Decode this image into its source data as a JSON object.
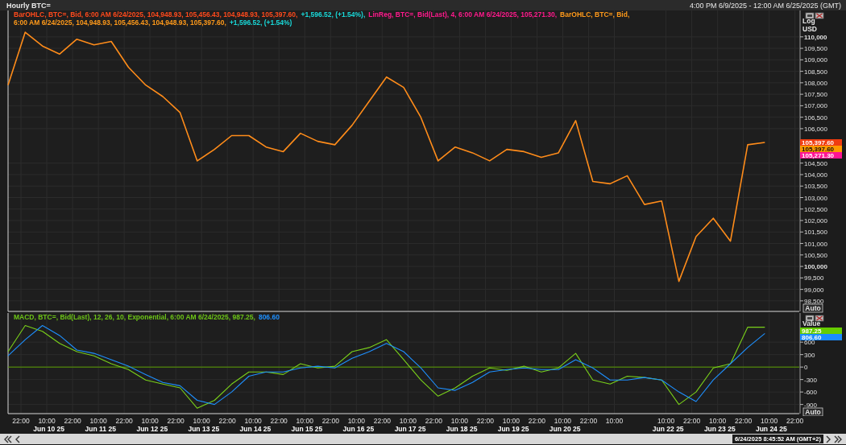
{
  "window": {
    "title": "Hourly BTC=",
    "range": "4:00 PM 6/9/2025 - 12:00 AM 6/25/2025 (GMT)"
  },
  "price_pane": {
    "legend": [
      [
        {
          "text": "BarOHLC, BTC=, Bid,  6:00 AM 6/24/2025, 104,948.93, 105,456.43, 104,948.93, 105,397.60,",
          "color": "#ff4a1c"
        },
        {
          "text": "+1,596.52, (+1.54%),",
          "color": "#19d8d8"
        },
        {
          "text": "LinReg, BTC=, Bid(Last),  4, 6:00 AM 6/24/2025, 105,271.30,",
          "color": "#ff1a8c"
        },
        {
          "text": "BarOHLC, BTC=, Bid,",
          "color": "#ff9a1a"
        }
      ],
      [
        {
          "text": "6:00 AM 6/24/2025, 104,948.93, 105,456.43, 104,948.93, 105,397.60,",
          "color": "#ff9a1a"
        },
        {
          "text": "+1,596.52, (+1.54%)",
          "color": "#19d8d8"
        }
      ]
    ],
    "axis": {
      "scale": "Log",
      "currency": "USD",
      "auto": "Auto",
      "badges": [
        {
          "text": "105,397.60",
          "color": "#f03c10"
        },
        {
          "text": "105,397.60",
          "color": "#ff9900"
        },
        {
          "text": "105,271.30",
          "color": "#ff1493"
        }
      ]
    },
    "chart_data": {
      "type": "line",
      "grid": true,
      "ylim": [
        98040,
        111150
      ],
      "yticks": [
        {
          "value": 110000,
          "label": "110,000"
        },
        {
          "value": 109500,
          "label": "109,500"
        },
        {
          "value": 109000,
          "label": "109,000"
        },
        {
          "value": 108500,
          "label": "108,500"
        },
        {
          "value": 108000,
          "label": "108,000"
        },
        {
          "value": 107500,
          "label": "107,500"
        },
        {
          "value": 107000,
          "label": "107,000"
        },
        {
          "value": 106500,
          "label": "106,500"
        },
        {
          "value": 106000,
          "label": "106,000"
        },
        {
          "value": 104500,
          "label": "104,500"
        },
        {
          "value": 104000,
          "label": "104,000"
        },
        {
          "value": 103500,
          "label": "103,500"
        },
        {
          "value": 103000,
          "label": "103,000"
        },
        {
          "value": 102500,
          "label": "102,500"
        },
        {
          "value": 102000,
          "label": "102,000"
        },
        {
          "value": 101500,
          "label": "101,500"
        },
        {
          "value": 101000,
          "label": "101,000"
        },
        {
          "value": 100500,
          "label": "100,500"
        },
        {
          "value": 100000,
          "label": "100,000"
        },
        {
          "value": 99500,
          "label": "99,500"
        },
        {
          "value": 99000,
          "label": "99,000"
        },
        {
          "value": 98500,
          "label": "98,500"
        }
      ],
      "series": [
        {
          "color": "#ff8c1a",
          "values": [
            107900,
            110200,
            109600,
            109250,
            109900,
            109650,
            109800,
            108680,
            107900,
            107400,
            106700,
            104600,
            105100,
            105700,
            105700,
            105200,
            105000,
            105800,
            105450,
            105300,
            106150,
            107200,
            108250,
            107800,
            106500,
            104600,
            105200,
            104950,
            104600,
            105100,
            105000,
            104750,
            104950,
            106350,
            103700,
            103600,
            103950,
            102700,
            102850,
            99350,
            101300,
            102100,
            101100,
            105300,
            105400
          ]
        }
      ]
    }
  },
  "macd_pane": {
    "legend": [
      {
        "text": "MACD, BTC=, Bid(Last),  12, 26, 10, Exponential, 6:00 AM 6/24/2025, 987.25,",
        "color": "#6cc417"
      },
      {
        "text": "806.60",
        "color": "#1e90ff"
      }
    ],
    "axis": {
      "title": "Value",
      "auto": "Auto",
      "badges": [
        {
          "text": "987.25",
          "color": "#66cc00"
        },
        {
          "text": "806.60",
          "color": "#1a8cff"
        }
      ]
    },
    "chart_data": {
      "type": "line",
      "grid": true,
      "ref_lines": [
        {
          "axis": "y",
          "value": 0,
          "color": "#5aa000"
        }
      ],
      "ylim": [
        -1120,
        1300
      ],
      "yticks": [
        {
          "value": 600,
          "label": "600"
        },
        {
          "value": 300,
          "label": "300"
        },
        {
          "value": 0,
          "label": "0"
        },
        {
          "value": -300,
          "label": "-300"
        },
        {
          "value": -600,
          "label": "-600"
        },
        {
          "value": -900,
          "label": "-900"
        }
      ],
      "series": [
        {
          "color": "#7ad11a",
          "values": [
            370,
            1000,
            860,
            570,
            370,
            270,
            80,
            -60,
            -310,
            -410,
            -500,
            -990,
            -800,
            -410,
            -120,
            -120,
            -180,
            80,
            -20,
            20,
            370,
            470,
            660,
            180,
            -310,
            -700,
            -500,
            -220,
            -20,
            -80,
            20,
            -120,
            -20,
            330,
            -310,
            -410,
            -220,
            -250,
            -310,
            -900,
            -600,
            -20,
            80,
            960,
            960
          ]
        },
        {
          "color": "#1e90ff",
          "values": [
            270,
            660,
            1000,
            760,
            410,
            330,
            180,
            20,
            -180,
            -370,
            -450,
            -800,
            -900,
            -600,
            -220,
            -120,
            -120,
            -20,
            20,
            -20,
            210,
            370,
            570,
            370,
            -20,
            -500,
            -560,
            -370,
            -120,
            -60,
            -20,
            -60,
            -60,
            180,
            -20,
            -310,
            -310,
            -250,
            -310,
            -600,
            -830,
            -310,
            80,
            470,
            810
          ]
        }
      ]
    }
  },
  "time_axis": {
    "days": [
      {
        "pm": "22:00"
      },
      {
        "date": "Jun 10 25",
        "am": "10:00",
        "pm": "22:00"
      },
      {
        "date": "Jun 11 25",
        "am": "10:00",
        "pm": "22:00"
      },
      {
        "date": "Jun 12 25",
        "am": "10:00",
        "pm": "22:00"
      },
      {
        "date": "Jun 13 25",
        "am": "10:00",
        "pm": "22:00"
      },
      {
        "date": "Jun 14 25",
        "am": "10:00",
        "pm": "22:00"
      },
      {
        "date": "Jun 15 25",
        "am": "10:00",
        "pm": "22:00"
      },
      {
        "date": "Jun 16 25",
        "am": "10:00",
        "pm": "22:00"
      },
      {
        "date": "Jun 17 25",
        "am": "10:00",
        "pm": "22:00"
      },
      {
        "date": "Jun 18 25",
        "am": "10:00",
        "pm": "22:00"
      },
      {
        "date": "Jun 19 25",
        "am": "10:00",
        "pm": "22:00"
      },
      {
        "date": "Jun 20 25",
        "am": "10:00",
        "pm": "22:00"
      },
      {
        "am": "10:00"
      },
      {
        "date": "Jun 22 25",
        "am": "10:00",
        "pm": "22:00"
      },
      {
        "date": "Jun 23 25",
        "am": "10:00",
        "pm": "22:00"
      },
      {
        "date": "Jun 24 25",
        "am": "10:00",
        "pm": "22:00"
      }
    ]
  },
  "status_bar": {
    "timestamp": "6/24/2025 8:45:52 AM (GMT+2)"
  }
}
